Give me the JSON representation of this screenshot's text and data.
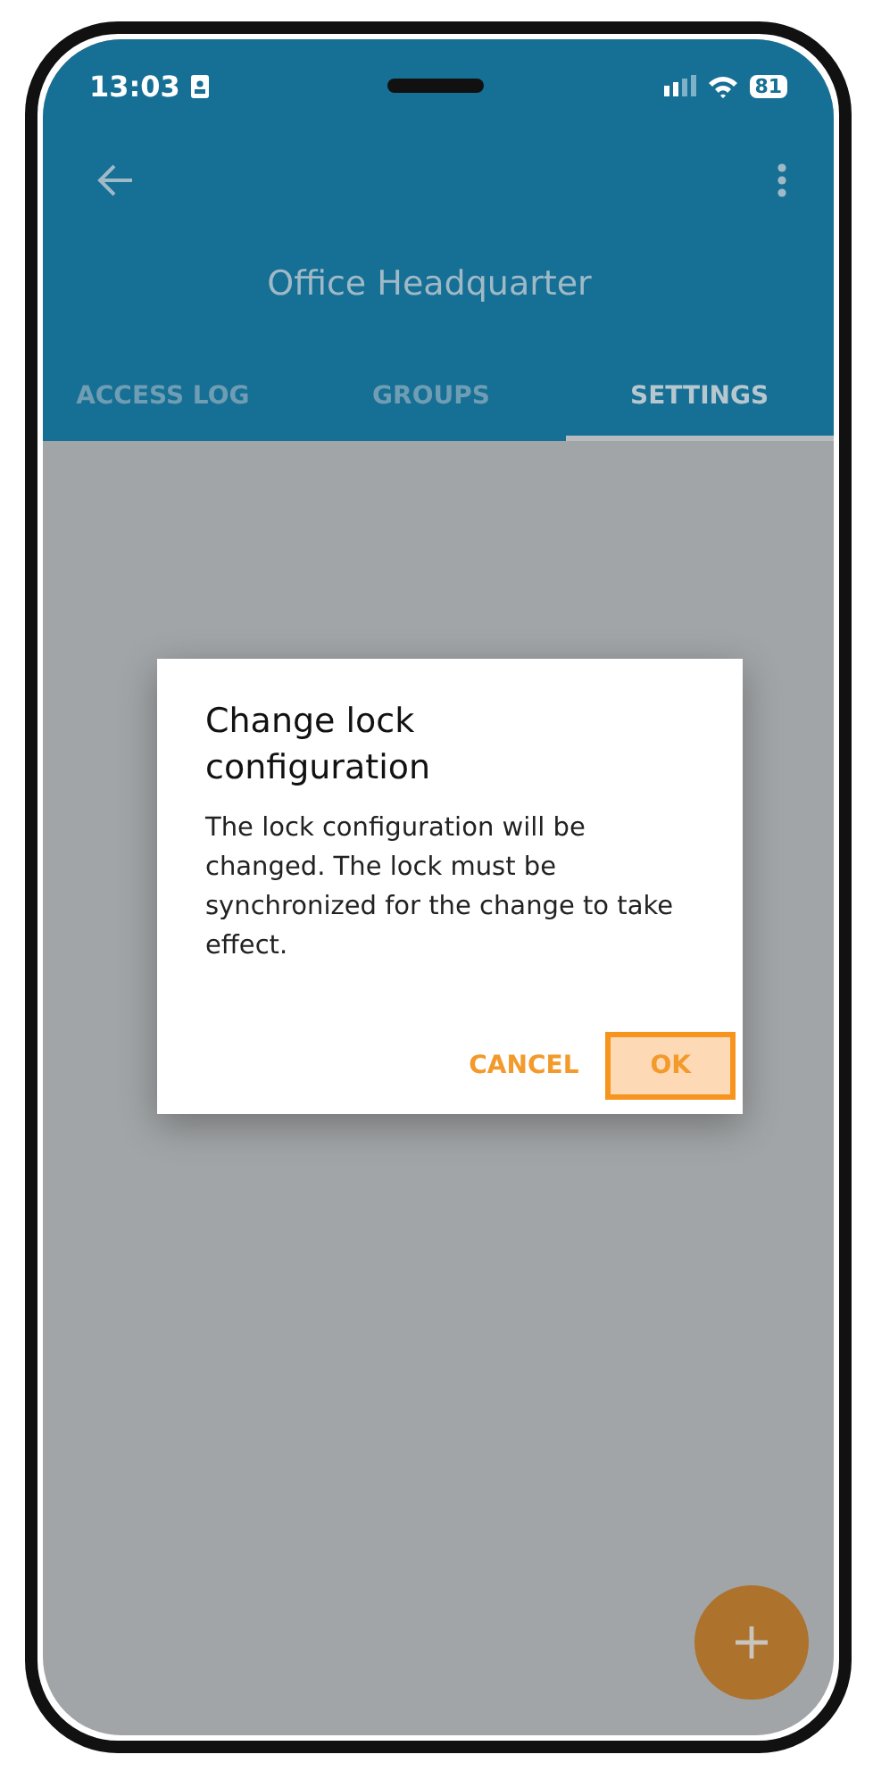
{
  "status_bar": {
    "time": "13:03",
    "battery": "81"
  },
  "app_bar": {
    "title": "Office Headquarter"
  },
  "tabs": [
    {
      "label": "ACCESS LOG",
      "selected": false
    },
    {
      "label": "GROUPS",
      "selected": false
    },
    {
      "label": "SETTINGS",
      "selected": true
    }
  ],
  "dialog": {
    "title": "Change lock configuration",
    "message": "The lock configuration will be changed. The lock must be synchronized for the change to take effect.",
    "buttons": [
      {
        "label": "CANCEL",
        "selected": false
      },
      {
        "label": "OK",
        "selected": true
      }
    ]
  }
}
